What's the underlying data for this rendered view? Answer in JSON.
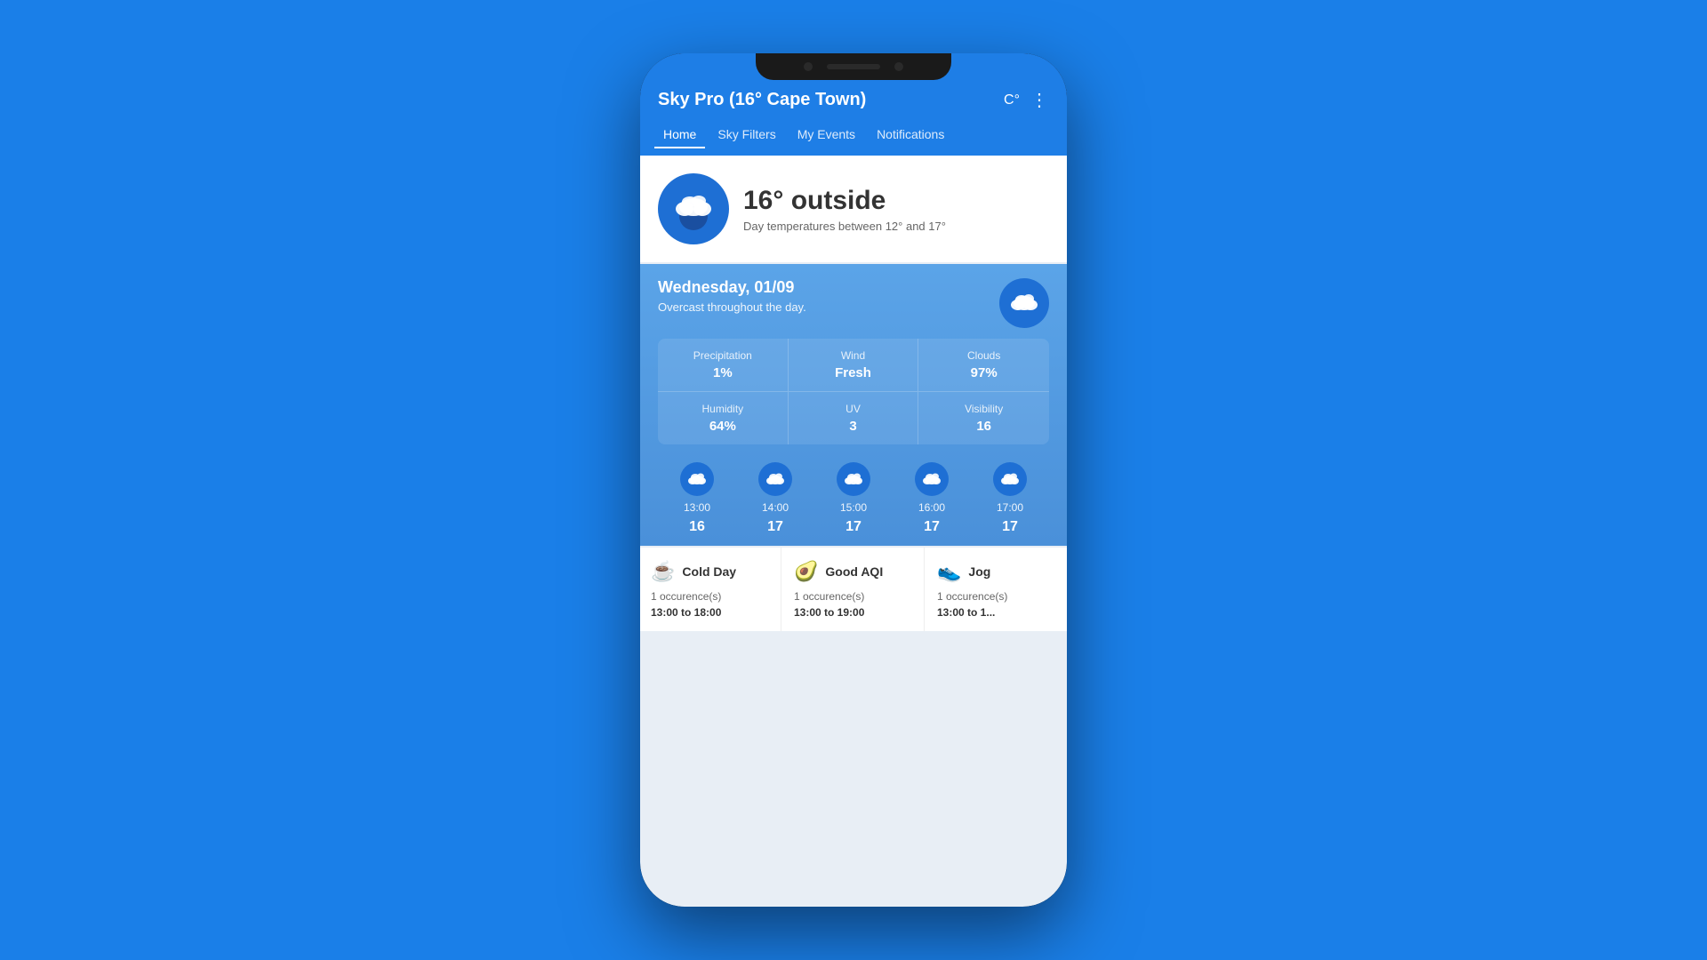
{
  "app": {
    "title": "Sky Pro (16° Cape Town)",
    "temp_unit": "C°",
    "more_icon": "⋮"
  },
  "nav": {
    "tabs": [
      {
        "label": "Home",
        "active": true
      },
      {
        "label": "Sky Filters",
        "active": false
      },
      {
        "label": "My Events",
        "active": false
      },
      {
        "label": "Notifications",
        "active": false
      }
    ]
  },
  "current_weather": {
    "temperature": "16° outside",
    "description": "Day temperatures between 12° and 17°"
  },
  "day_forecast": {
    "date": "Wednesday, 01/09",
    "condition": "Overcast throughout the day."
  },
  "stats": [
    {
      "label": "Precipitation",
      "value": "1%"
    },
    {
      "label": "Wind",
      "value": "Fresh"
    },
    {
      "label": "Clouds",
      "value": "97%"
    },
    {
      "label": "Humidity",
      "value": "64%"
    },
    {
      "label": "UV",
      "value": "3"
    },
    {
      "label": "Visibility",
      "value": "16"
    }
  ],
  "hourly": [
    {
      "time": "13:00",
      "temp": "16"
    },
    {
      "time": "14:00",
      "temp": "17"
    },
    {
      "time": "15:00",
      "temp": "17"
    },
    {
      "time": "16:00",
      "temp": "17"
    },
    {
      "time": "17:00",
      "temp": "17"
    }
  ],
  "events": [
    {
      "icon": "☕",
      "name": "Cold Day",
      "count": "1 occurence(s)",
      "time": "13:00 to 18:00"
    },
    {
      "icon": "🥑",
      "name": "Good AQI",
      "count": "1 occurence(s)",
      "time": "13:00 to 19:00"
    },
    {
      "icon": "👟",
      "name": "Jog",
      "count": "1 occurence(s)",
      "time": "13:00 to 1..."
    }
  ]
}
